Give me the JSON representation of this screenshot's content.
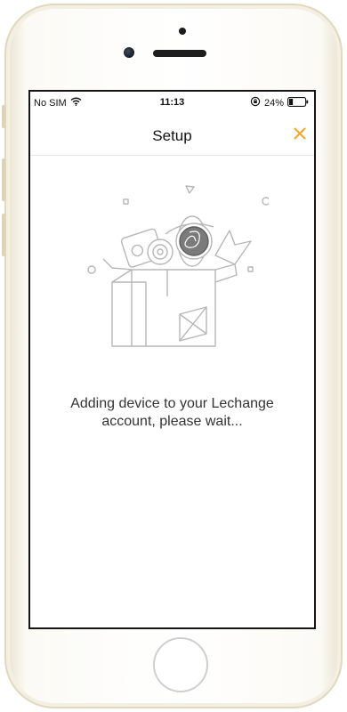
{
  "status_bar": {
    "carrier": "No SIM",
    "time": "11:13",
    "battery_percent": "24%",
    "battery_level": 0.24,
    "icons": [
      "wifi-icon",
      "rotation-lock-icon",
      "battery-icon"
    ]
  },
  "nav": {
    "title": "Setup",
    "close_icon": "close-icon"
  },
  "main": {
    "illustration": "device-box-illustration",
    "message_line1": "Adding device to your Lechange",
    "message_line2": "account, please wait..."
  },
  "colors": {
    "accent": "#f5a623",
    "illustration_stroke": "#b7b7b7",
    "text": "#333333",
    "frame": "#e2d8bd"
  }
}
